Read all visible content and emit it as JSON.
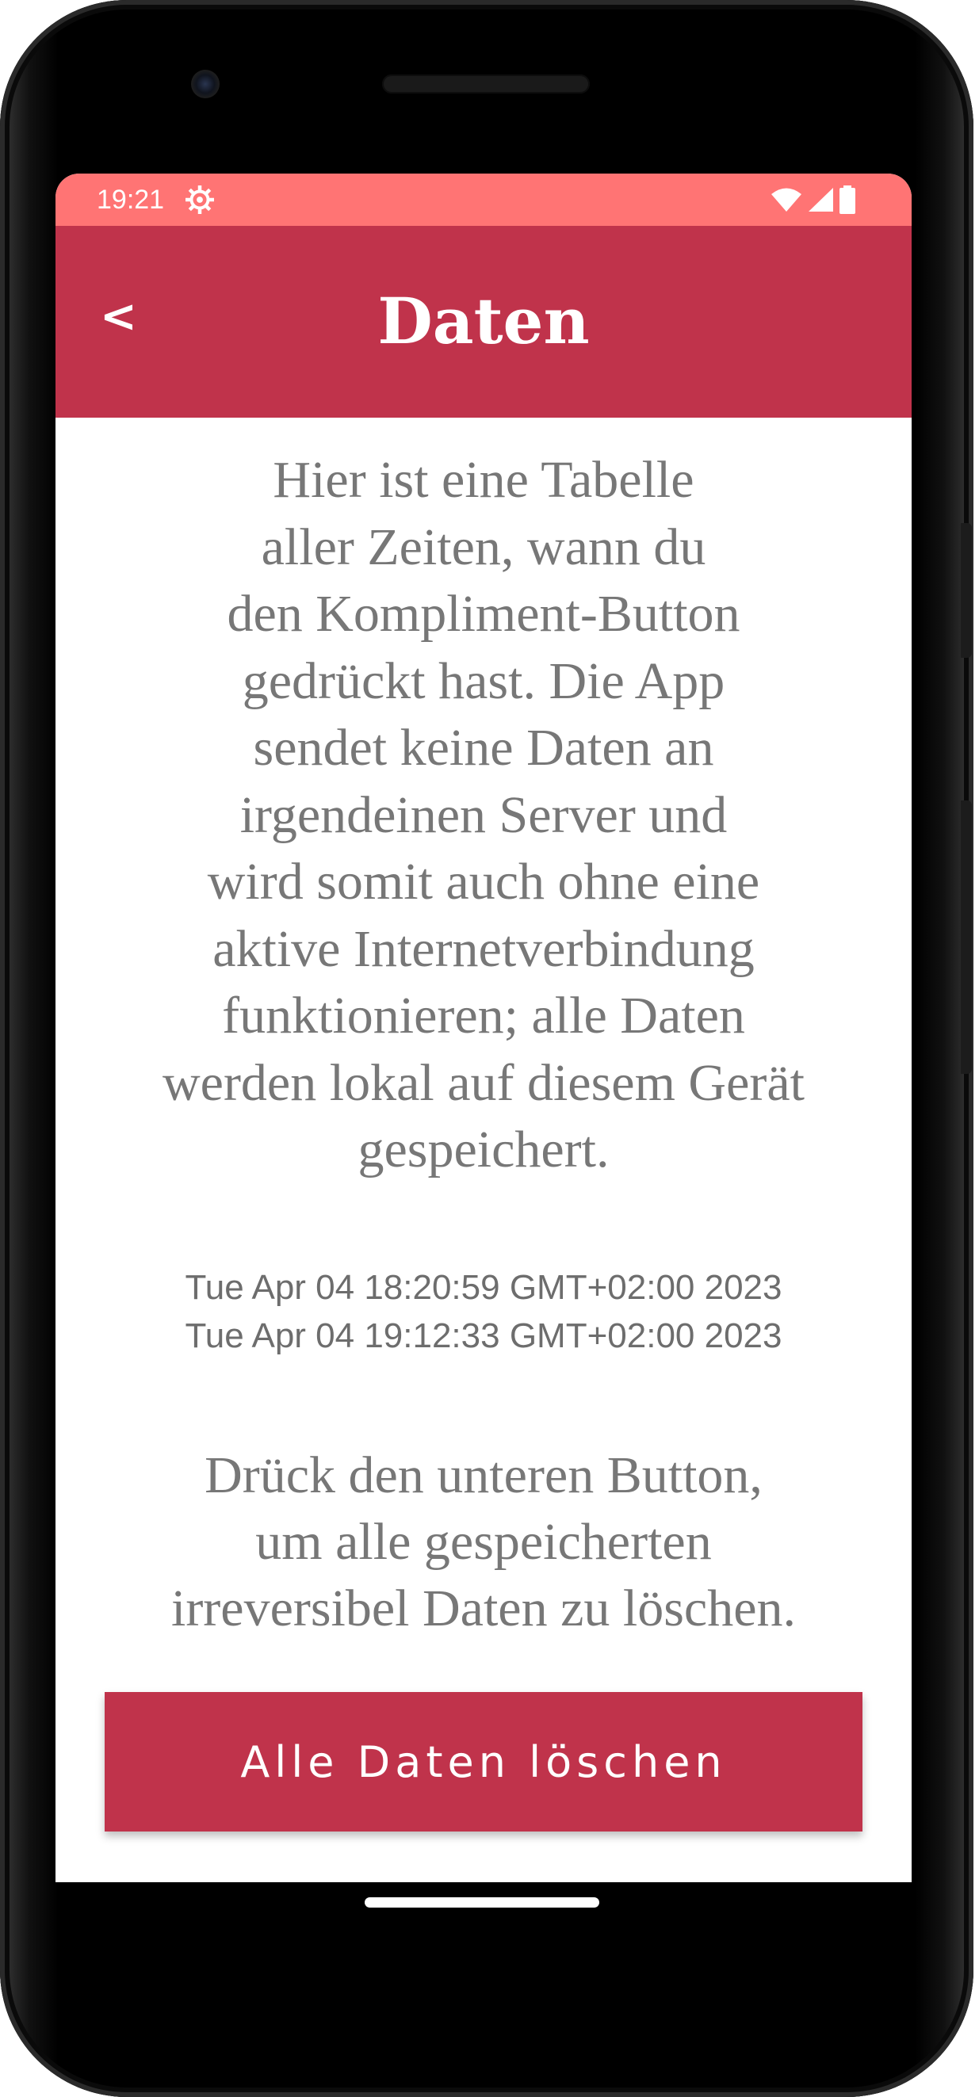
{
  "status_bar": {
    "time": "19:21",
    "icons": [
      "settings-icon",
      "wifi-icon",
      "signal-icon",
      "battery-icon"
    ]
  },
  "app_bar": {
    "back_label": "<",
    "title": "Daten"
  },
  "intro": {
    "lines": [
      "Hier ist eine Tabelle",
      "aller Zeiten, wann du",
      "den Kompliment-Button",
      "gedrückt hast. Die App",
      "sendet keine Daten an",
      "irgendeinen Server und",
      "wird somit auch ohne eine",
      "aktive Internetverbindung",
      "funktionieren; alle Daten",
      "werden lokal auf diesem Gerät",
      "gespeichert."
    ]
  },
  "timestamps": [
    "Tue Apr 04 18:20:59 GMT+02:00 2023",
    "Tue Apr 04 19:12:33 GMT+02:00 2023"
  ],
  "hint": {
    "lines": [
      "Drück den unteren Button,",
      "um alle gespeicherten",
      "irreversibel Daten zu löschen."
    ]
  },
  "delete_button": {
    "label": "Alle Daten löschen"
  },
  "colors": {
    "status_bar": "#ff7474",
    "primary": "#c0334b",
    "body_text": "#777777",
    "timestamp_text": "#6d6d6d"
  }
}
